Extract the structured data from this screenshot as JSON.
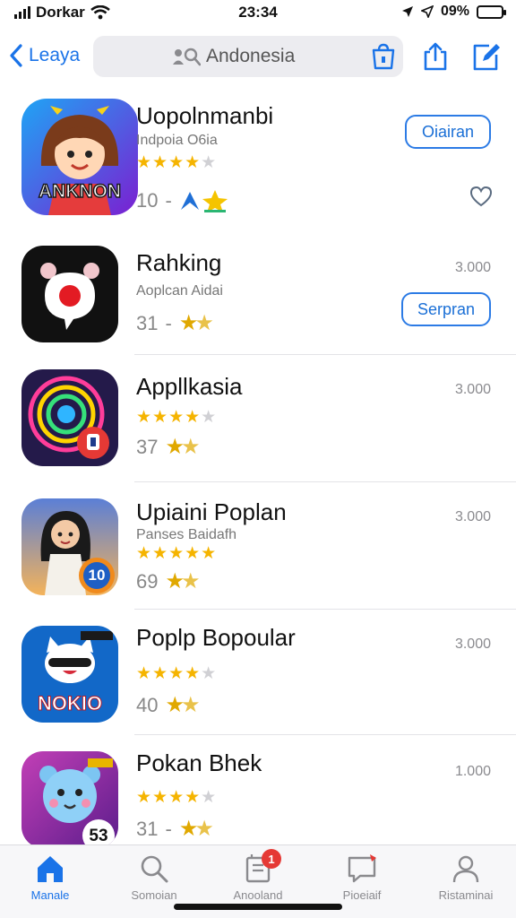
{
  "status": {
    "carrier": "Dorkar",
    "time": "23:34",
    "battery": "09%",
    "battery_level": 0.9
  },
  "nav": {
    "back_label": "Leaya",
    "search_value": "Andonesia",
    "search_icon": "person-search-icon",
    "bag_icon": "shopping-bag-icon",
    "share_icon": "share-icon",
    "edit_icon": "compose-icon"
  },
  "apps": [
    {
      "title": "Uopolnmanbi",
      "subtitle": "Indpoia O6ia",
      "rating_stars": 4,
      "meta_count": "10",
      "meta_sep": "-",
      "action_label": "Oiairan",
      "icon_text": "ANKNON",
      "colors": {
        "bg_start": "#1fa4f5",
        "bg_end": "#7b1fd1"
      }
    },
    {
      "title": "Rahking",
      "subtitle": "Aoplcan Aidai",
      "meta_count": "31",
      "meta_sep": "-",
      "price": "3.000",
      "action_label": "Serpran",
      "colors": {
        "bg": "#111111"
      }
    },
    {
      "title": "Appllkasia",
      "rating_stars": 4,
      "meta_count": "37",
      "price": "3.000",
      "colors": {
        "bg": "#241a4a"
      }
    },
    {
      "title": "Upiaini Poplan",
      "subtitle": "Panses Baidafh",
      "rating_stars": 5,
      "meta_count": "69",
      "price": "3.000",
      "icon_text": "10",
      "colors": {
        "bg": "#5b7fd6"
      }
    },
    {
      "title": "Poplp Bopoular",
      "rating_stars": 4,
      "meta_count": "40",
      "price": "3.000",
      "icon_text": "NOKIO",
      "colors": {
        "bg": "#1268c8"
      }
    },
    {
      "title": "Pokan Bhek",
      "rating_stars": 4,
      "meta_count": "31",
      "meta_sep": "-",
      "price": "1.000",
      "icon_text": "53",
      "colors": {
        "bg": "#9b2aa8"
      }
    }
  ],
  "tabs": [
    {
      "label": "Manale",
      "icon": "home-icon",
      "active": true
    },
    {
      "label": "Somoian",
      "icon": "search-icon"
    },
    {
      "label": "Anooland",
      "icon": "updates-icon",
      "badge": "1"
    },
    {
      "label": "Pioeiaif",
      "icon": "message-icon"
    },
    {
      "label": "Ristaminai",
      "icon": "person-icon"
    }
  ],
  "colors": {
    "accent": "#1a73e8",
    "star": "#f5b400",
    "badge": "#e53935"
  }
}
